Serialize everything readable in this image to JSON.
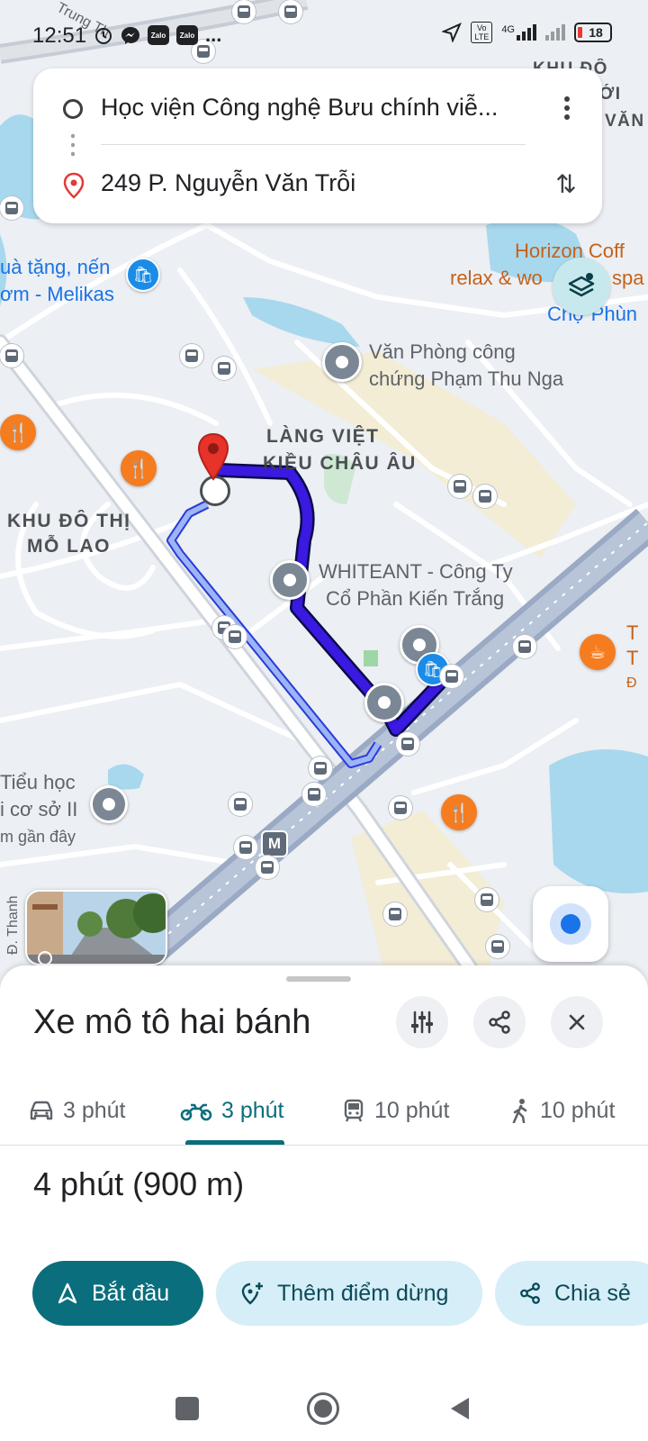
{
  "status_bar": {
    "time": "12:51",
    "zalo_badge": "Zalo",
    "more": "...",
    "network": "4G",
    "volte": "Vo LTE",
    "battery": "18"
  },
  "directions": {
    "origin": "Học viện Công nghệ Bưu chính viễ...",
    "destination": "249 P. Nguyễn Văn Trỗi"
  },
  "map": {
    "labels": {
      "lang_viet_1": "LÀNG VIỆT",
      "lang_viet_2": "KIỀU CHÂU ÂU",
      "khu_do_thi_1": "KHU ĐÔ THỊ",
      "khu_do_thi_2": "MỖ LAO",
      "van_phong_1": "Văn Phòng công",
      "van_phong_2": "chứng Phạm Thu Nga",
      "whiteant_1": "WHITEANT - Công Ty",
      "whiteant_2": "Cổ Phần Kiến Trắng",
      "melikas_1": "uà tặng, nến",
      "melikas_2": "ơm - Melikas",
      "horizon_1": "Horizon Coff",
      "horizon_2": "relax & wo",
      "horizon_3": "spa",
      "cho_phung": "Chợ Phùn",
      "tieu_hoc_1": "Tiểu học",
      "tieu_hoc_2": "i cơ sở II",
      "tieu_hoc_3": "m gần đây",
      "khu_do_top_1": "KHU ĐÔ",
      "khu_do_top_2": "ỚI",
      "khu_do_top_3": "VĂN",
      "street_top": "Trung Th",
      "street_left": "Đ. Thanh",
      "metro_letter": "M",
      "right_t1": "T",
      "right_t2": "T",
      "right_t3": "Đ"
    },
    "icons": {
      "restaurant": "fork-knife-icon",
      "shopping": "shopping-bag-icon",
      "cafe": "coffee-icon",
      "school": "school-icon",
      "bus": "bus-stop-icon"
    },
    "colors": {
      "route_primary": "#3a19e0",
      "route_alt": "#8aa6f5",
      "water": "#a8d8ee",
      "park": "#cfe8d3",
      "accent_teal": "#0b6e7d"
    }
  },
  "sheet": {
    "title": "Xe mô tô hai bánh",
    "tabs": [
      {
        "label": "3 phút",
        "icon": "car-icon",
        "active": false
      },
      {
        "label": "3 phút",
        "icon": "motorbike-icon",
        "active": true
      },
      {
        "label": "10 phút",
        "icon": "transit-icon",
        "active": false
      },
      {
        "label": "10 phút",
        "icon": "walk-icon",
        "active": false
      }
    ],
    "duration": "4 phút (900 m)",
    "actions": {
      "start": "Bắt đầu",
      "add_stop": "Thêm điểm dừng",
      "share": "Chia sẻ"
    }
  }
}
